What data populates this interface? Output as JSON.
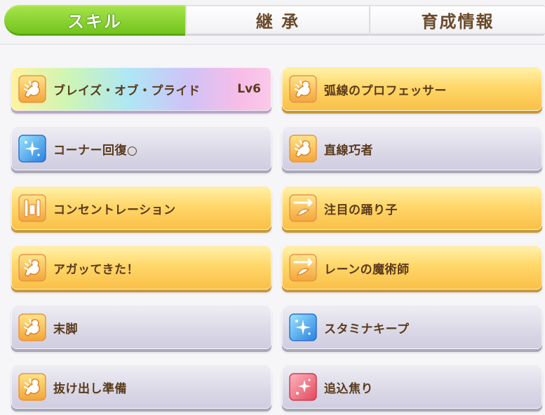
{
  "tabs": [
    {
      "label": "スキル",
      "active": true
    },
    {
      "label": "継 承",
      "active": false
    },
    {
      "label": "育成情報",
      "active": false
    }
  ],
  "skills": [
    {
      "name": "ブレイズ・オブ・プライド",
      "level": "Lv6",
      "style": "rainbow",
      "icon": "speed-boost-icon"
    },
    {
      "name": "弧線のプロフェッサー",
      "style": "gold",
      "icon": "speed-boost-icon"
    },
    {
      "name": "コーナー回復○",
      "style": "gray",
      "icon": "stamina-recovery-icon"
    },
    {
      "name": "直線巧者",
      "style": "gray",
      "icon": "speed-boost-icon"
    },
    {
      "name": "コンセントレーション",
      "style": "gold",
      "icon": "gate-start-icon"
    },
    {
      "name": "注目の踊り子",
      "style": "gold",
      "icon": "debuff-arrow-icon"
    },
    {
      "name": "アガッてきた！",
      "style": "gold",
      "icon": "speed-boost-icon"
    },
    {
      "name": "レーンの魔術師",
      "style": "gold",
      "icon": "debuff-arrow-icon"
    },
    {
      "name": "末脚",
      "style": "gray",
      "icon": "speed-boost-icon"
    },
    {
      "name": "スタミナキープ",
      "style": "gray",
      "icon": "stamina-recovery-icon"
    },
    {
      "name": "抜け出し準備",
      "style": "gray",
      "icon": "speed-boost-icon"
    },
    {
      "name": "追込焦り",
      "style": "gray",
      "icon": "red-sparkle-icon"
    }
  ]
}
